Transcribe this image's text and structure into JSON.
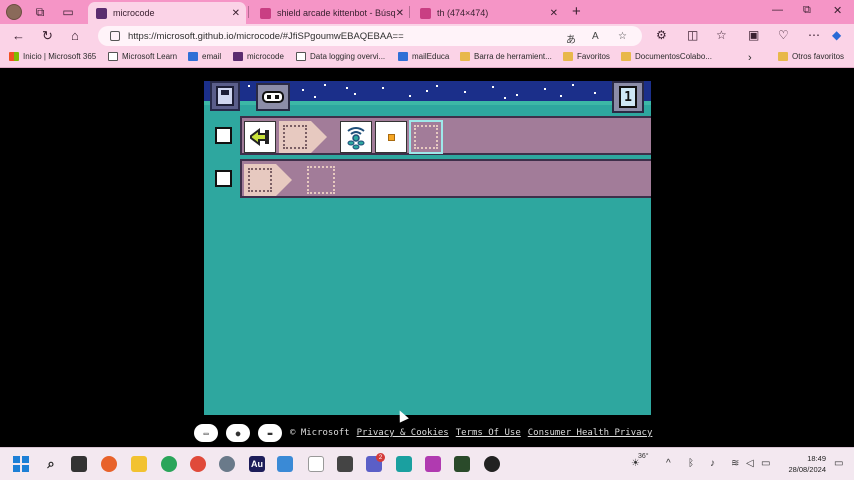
{
  "browser": {
    "tabs": [
      {
        "title": "microcode",
        "active": true
      },
      {
        "title": "shield arcade kittenbot - Búsqueda",
        "active": false
      },
      {
        "title": "th (474×474)",
        "active": false
      }
    ],
    "new_tab": "+",
    "window_controls": {
      "minimize": "—",
      "restore": "⧉",
      "close": "✕"
    },
    "url": "https://microsoft.github.io/microcode/#JfiSPgoumwEBAQEBAA==",
    "bookmarks": [
      "Inicio | Microsoft 365",
      "Microsoft Learn",
      "email",
      "microcode",
      "Data logging overvi...",
      "mailEduca",
      "Barra de herramient...",
      "Favoritos",
      "DocumentosColabo...",
      "Otros favoritos"
    ]
  },
  "editor": {
    "page_number": "1",
    "rules": [
      {
        "when": "button-a-press",
        "do": [
          "radio-send",
          "small-dot"
        ]
      },
      {
        "when": "empty",
        "do": []
      }
    ]
  },
  "footer": {
    "copyright": "© Microsoft",
    "links": [
      "Privacy & Cookies",
      "Terms Of Use",
      "Consumer Health Privacy"
    ],
    "mini_buttons": [
      "book-icon",
      "chat-icon",
      "device-icon"
    ]
  },
  "taskbar": {
    "weather": "36°",
    "time": "18:49",
    "date": "28/08/2024",
    "teams_badge": "2"
  },
  "colors": {
    "tab_strip": "#f595c6",
    "game_bg": "#2ea79f",
    "rule_bg": "#a27c99",
    "sky": "#1b2f8a"
  }
}
